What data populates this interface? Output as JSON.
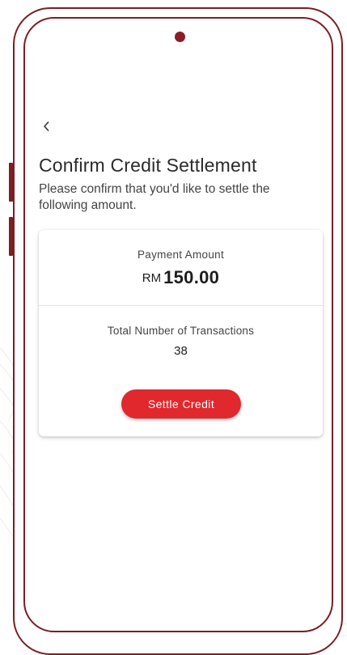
{
  "colors": {
    "frame": "#7a1f24",
    "camera": "#8b1e24",
    "primary_button": "#e0282d",
    "title_text": "#2a2a2a",
    "body_text": "#444444"
  },
  "header": {
    "back_icon": "chevron-left-icon",
    "title": "Confirm Credit Settlement",
    "subtitle": "Please confirm that you'd like to settle the following amount."
  },
  "card": {
    "payment_label": "Payment Amount",
    "currency": "RM",
    "amount": "150.00",
    "transactions_label": "Total Number of Transactions",
    "transactions_count": "38",
    "settle_button_label": "Settle Credit"
  }
}
